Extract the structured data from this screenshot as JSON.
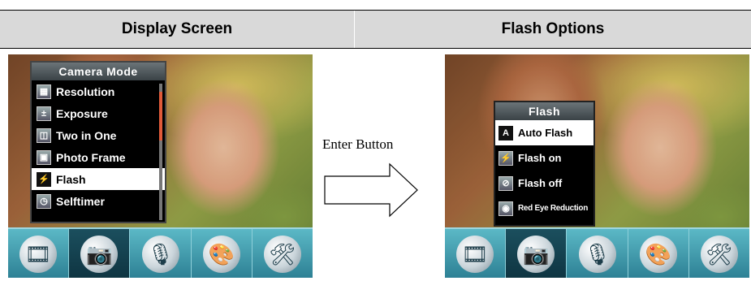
{
  "headers": {
    "left": "Display Screen",
    "right": "Flash Options"
  },
  "left_screen": {
    "menu_title": "Camera Mode",
    "items": [
      {
        "label": "Resolution",
        "icon": "resolution-icon"
      },
      {
        "label": "Exposure",
        "icon": "exposure-icon"
      },
      {
        "label": "Two in One",
        "icon": "two-in-one-icon"
      },
      {
        "label": "Photo Frame",
        "icon": "photo-frame-icon"
      },
      {
        "label": "Flash",
        "icon": "flash-icon",
        "selected": true
      },
      {
        "label": "Selftimer",
        "icon": "selftimer-icon"
      }
    ]
  },
  "right_screen": {
    "menu_title": "Flash",
    "items": [
      {
        "label": "Auto Flash",
        "icon": "auto-flash-icon",
        "selected": true
      },
      {
        "label": "Flash on",
        "icon": "flash-on-icon"
      },
      {
        "label": "Flash off",
        "icon": "flash-off-icon"
      },
      {
        "label": "Red Eye Reduction",
        "icon": "red-eye-icon"
      }
    ]
  },
  "toolbar": {
    "items": [
      "video-mode-icon",
      "camera-mode-icon",
      "voice-mode-icon",
      "playback-icon",
      "settings-icon"
    ],
    "active_index": 1
  },
  "transition": {
    "label": "Enter Button"
  },
  "colors": {
    "header_bg": "#d9d9d9",
    "toolbar": "#3b98aa",
    "menu_bg": "#000000"
  }
}
